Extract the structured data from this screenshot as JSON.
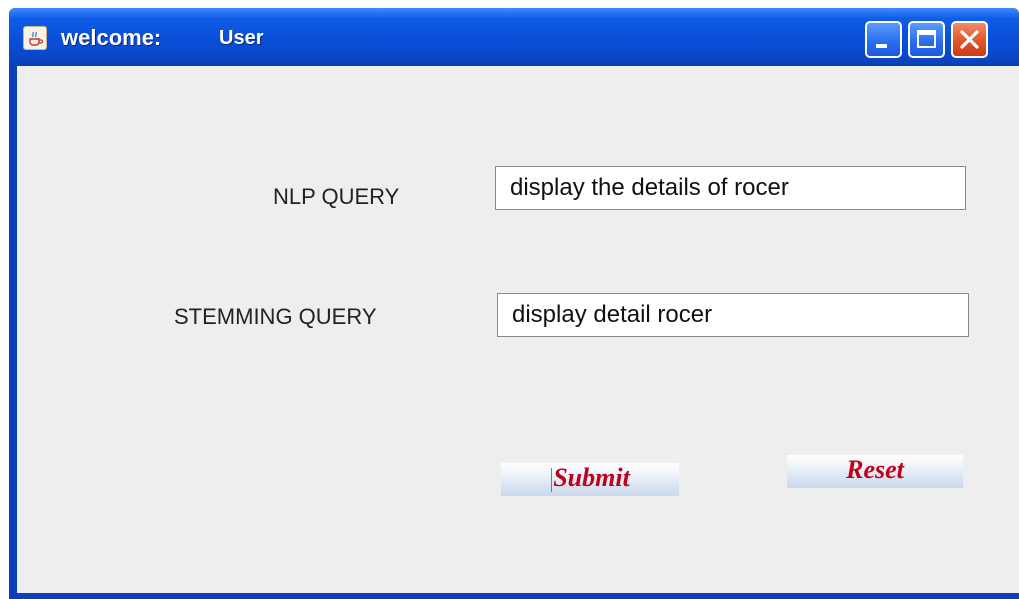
{
  "window": {
    "title": "welcome:",
    "user": "User",
    "icon": "java-coffee-icon",
    "controls": [
      "minimize-icon",
      "maximize-icon",
      "close-icon"
    ]
  },
  "form": {
    "nlp_label": "NLP QUERY",
    "nlp_value": "display the details of rocer",
    "stem_label": "STEMMING QUERY",
    "stem_value": "display detail rocer"
  },
  "buttons": {
    "submit": "Submit",
    "reset": "Reset"
  },
  "colors": {
    "titlebar": "#0a4fd8",
    "background": "#eeeeee",
    "button_text": "#c0001a",
    "close_button": "#e2542a"
  }
}
